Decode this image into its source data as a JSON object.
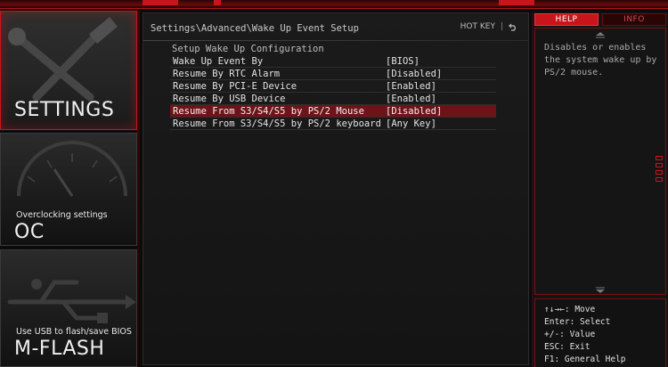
{
  "sidebar": {
    "settings": {
      "title": "SETTINGS"
    },
    "oc": {
      "subtitle": "Overclocking settings",
      "title": "OC"
    },
    "mflash": {
      "subtitle": "Use USB to flash/save BIOS",
      "title": "M-FLASH"
    }
  },
  "main": {
    "breadcrumb": "Settings\\Advanced\\Wake Up Event Setup",
    "hotkey_label": "HOT KEY",
    "hotkey_separator": "|",
    "section_title": "Setup Wake Up Configuration",
    "rows": [
      {
        "label": "Wake Up Event By",
        "value": "[BIOS]"
      },
      {
        "label": "Resume By RTC Alarm",
        "value": "[Disabled]"
      },
      {
        "label": "Resume By PCI-E Device",
        "value": "[Enabled]"
      },
      {
        "label": "Resume By USB Device",
        "value": "[Enabled]"
      },
      {
        "label": "Resume From S3/S4/S5 by PS/2 Mouse",
        "value": "[Disabled]"
      },
      {
        "label": "Resume From S3/S4/S5 by PS/2 keyboard",
        "value": "[Any Key]"
      }
    ],
    "selected_row": 4
  },
  "help": {
    "tab_help": "HELP",
    "tab_info": "INFO",
    "text": "Disables or enables the system wake up by PS/2 mouse.",
    "keys": [
      "↑↓→←: Move",
      "Enter: Select",
      "+/-: Value",
      "ESC: Exit",
      "F1: General Help"
    ]
  },
  "colors": {
    "accent": "#c8151c",
    "selected_row": "#6e1418",
    "background": "#0b0b0b"
  }
}
